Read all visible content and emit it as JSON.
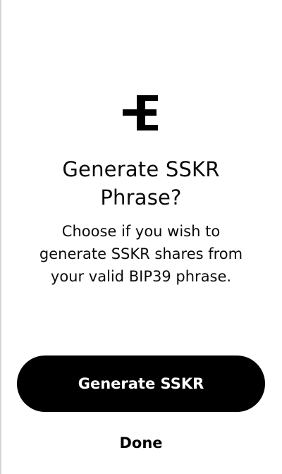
{
  "dialog": {
    "title": "Generate SSKR\nPhrase?",
    "description": "Choose if you wish to\ngenerate SSKR shares from\nyour valid BIP39 phrase.",
    "logo_icon": "sskr-logo-icon"
  },
  "actions": {
    "primary_label": "Generate SSKR",
    "secondary_label": "Done"
  },
  "colors": {
    "primary_button_bg": "#000000",
    "primary_button_text": "#ffffff",
    "text": "#0a0a0a"
  }
}
